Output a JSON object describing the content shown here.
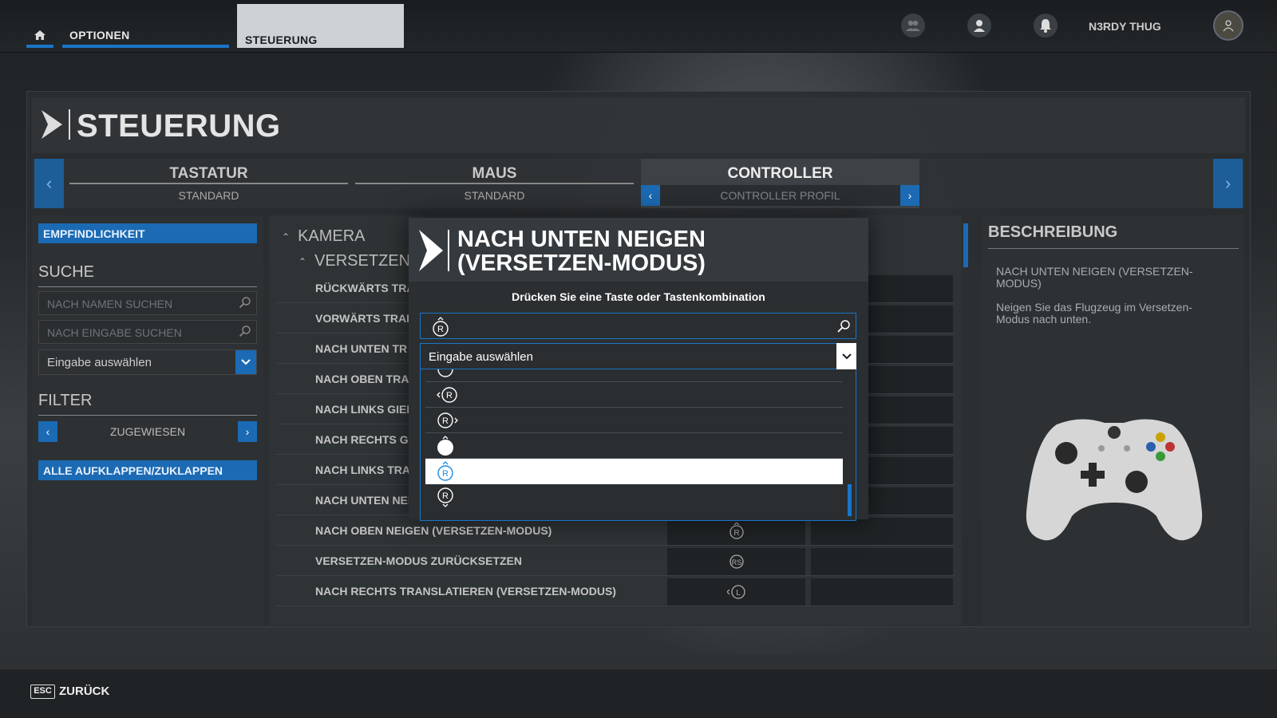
{
  "topbar": {
    "tabs": [
      "OPTIONEN",
      "STEUERUNG"
    ],
    "username": "N3RDY THUG",
    "icons": [
      "home-icon",
      "friends-icon",
      "profile-icon",
      "notification-icon",
      "avatar"
    ]
  },
  "page": {
    "title": "STEUERUNG"
  },
  "devices": [
    {
      "name": "TASTATUR",
      "sub": "STANDARD"
    },
    {
      "name": "MAUS",
      "sub": "STANDARD"
    },
    {
      "name": "CONTROLLER",
      "sub": "CONTROLLER PROFIL"
    }
  ],
  "sidebar": {
    "sensitivity": "EMPFINDLICHKEIT",
    "search_head": "SUCHE",
    "search_name_placeholder": "NACH NAMEN SUCHEN",
    "search_input_placeholder": "NACH EINGABE SUCHEN",
    "select_input": "Eingabe auswählen",
    "filter_head": "FILTER",
    "filter_value": "ZUGEWIESEN",
    "expand_all": "ALLE AUFKLAPPEN/ZUKLAPPEN"
  },
  "list": {
    "category": "KAMERA",
    "subcategory": "VERSETZEN-",
    "rows": [
      {
        "label": "RÜCKWÄRTS TRA"
      },
      {
        "label": "VORWÄRTS TRAI"
      },
      {
        "label": "NACH UNTEN TR"
      },
      {
        "label": "NACH OBEN TRA"
      },
      {
        "label": "NACH LINKS GIEI"
      },
      {
        "label": "NACH RECHTS G"
      },
      {
        "label": "NACH LINKS TRA"
      },
      {
        "label": "NACH UNTEN NEIG"
      },
      {
        "label": "NACH OBEN NEIGEN (VERSETZEN-MODUS)"
      },
      {
        "label": "VERSETZEN-MODUS ZURÜCKSETZEN"
      },
      {
        "label": "NACH RECHTS TRANSLATIEREN (VERSETZEN-MODUS)"
      }
    ]
  },
  "description": {
    "head": "BESCHREIBUNG",
    "title": "NACH UNTEN NEIGEN (VERSETZEN-MODUS)",
    "text": "Neigen Sie das Flugzeug im Versetzen-Modus nach unten."
  },
  "modal": {
    "title": "NACH UNTEN NEIGEN (VERSETZEN-MODUS)",
    "prompt": "Drücken Sie eine Taste oder Tastenkombination",
    "select": "Eingabe auswählen",
    "options": [
      "R-stick-left",
      "R-stick-right",
      "R-stick-up-filled",
      "R-stick-up-selected",
      "R-stick-down"
    ]
  },
  "footer": {
    "key": "ESC",
    "back": "ZURÜCK"
  },
  "colors": {
    "accent": "#1b6ab3",
    "panel": "#2a2e31",
    "text": "#dddddd"
  }
}
